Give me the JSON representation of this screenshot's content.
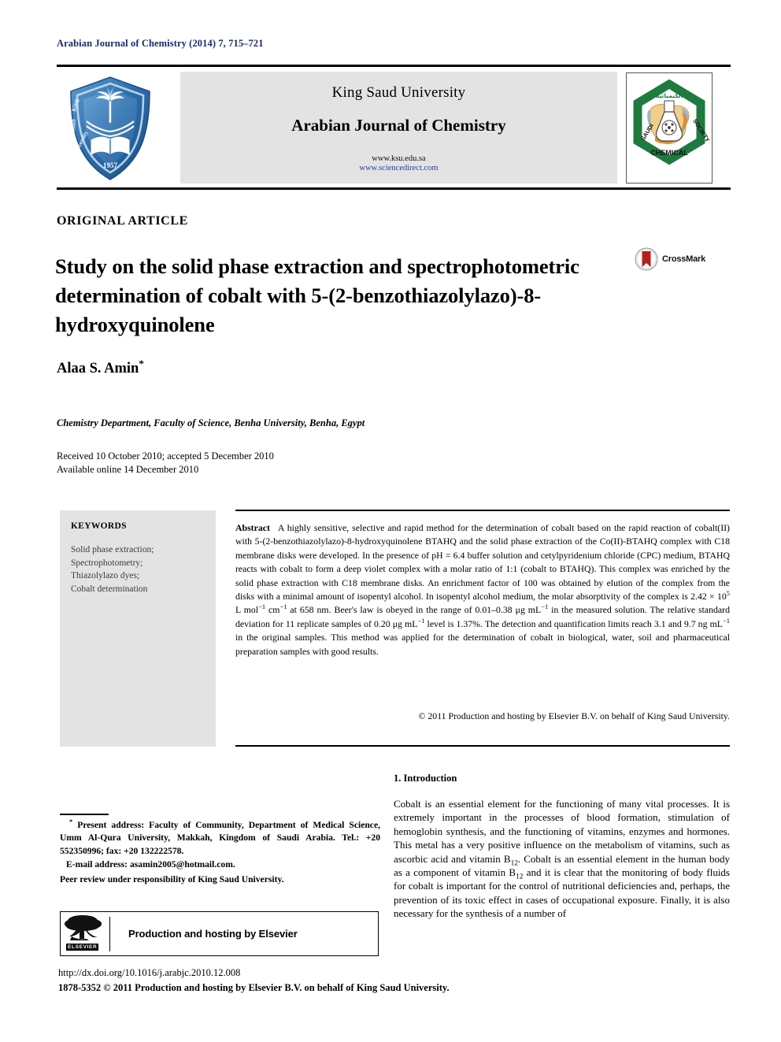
{
  "running_head": "Arabian Journal of Chemistry (2014) 7, 715–721",
  "banner": {
    "university": "King Saud University",
    "journal": "Arabian Journal of Chemistry",
    "url_ksu": "www.ksu.edu.sa",
    "url_sciencedirect": "www.sciencedirect.com",
    "left_logo": "king-saud-university-shield-logo",
    "left_logo_text_en": "King Saud University",
    "left_logo_year": "1957",
    "right_logo": "saudi-chemical-society-logo",
    "right_logo_text": [
      "SAUDI",
      "SOCIETY",
      "CHEMICAL"
    ]
  },
  "article": {
    "type": "ORIGINAL ARTICLE",
    "title": "Study on the solid phase extraction and spectrophotometric determination of cobalt with 5-(2-benzothiazolylazo)-8-hydroxyquinolene",
    "crossmark_label": "CrossMark",
    "author": "Alaa S. Amin",
    "author_marker": "*",
    "affiliation": "Chemistry Department, Faculty of Science, Benha University, Benha, Egypt",
    "received_line": "Received 10 October 2010; accepted 5 December 2010",
    "available_line": "Available online 14 December 2010"
  },
  "keywords": {
    "heading": "KEYWORDS",
    "items": [
      "Solid phase extraction;",
      "Spectrophotometry;",
      "Thiazolylazo dyes;",
      "Cobalt determination"
    ]
  },
  "abstract": {
    "label": "Abstract",
    "text_parts": {
      "p1": "A highly sensitive, selective and rapid method for the determination of cobalt based on the rapid reaction of cobalt(II) with 5-(2-benzothiazolylazo)-8-hydroxyquinolene BTAHQ and the solid phase extraction of the Co(II)-BTAHQ complex with C18 membrane disks were developed. In the presence of pH = 6.4 buffer solution and cetylpyridenium chloride (CPC) medium, BTAHQ reacts with cobalt to form a deep violet complex with a molar ratio of 1:1 (cobalt to BTAHQ). This complex was enriched by the solid phase extraction with C18 membrane disks. An enrichment factor of 100 was obtained by elution of the complex from the disks with a minimal amount of isopentyl alcohol. In isopentyl alcohol medium, the molar absorptivity of the complex is 2.42 × 10",
      "sup1": "5",
      "p2": " L mol",
      "sup2": "−1",
      "p3": " cm",
      "sup3": "−1",
      "p4": " at 658 nm. Beer's law is obeyed in the range of 0.01–0.38 μg mL",
      "sup4": "−1",
      "p5": " in the measured solution. The relative standard deviation for 11 replicate samples of 0.20 μg mL",
      "sup5": "−1",
      "p6": " level is 1.37%. The detection and quantification limits reach 3.1 and 9.7 ng mL",
      "sup6": "−1",
      "p7": " in the original samples. This method was applied for the determination of cobalt in biological, water, soil and pharmaceutical preparation samples with good results."
    },
    "copyright": "© 2011 Production and hosting by Elsevier B.V. on behalf of King Saud University."
  },
  "introduction": {
    "heading": "1. Introduction",
    "parts": {
      "t1": "Cobalt is an essential element for the functioning of many vital processes. It is extremely important in the processes of blood formation, stimulation of hemoglobin synthesis, and the functioning of vitamins, enzymes and hormones. This metal has a very positive influence on the metabolism of vitamins, such as ascorbic acid and vitamin B",
      "sub1": "12",
      "t2": ". Cobalt is an essential element in the human body as a component of vitamin B",
      "sub2": "12",
      "t3": " and it is clear that the monitoring of body fluids for cobalt is important for the control of nutritional deficiencies and, perhaps, the prevention of its toxic effect in cases of occupational exposure. Finally, it is also necessary for the synthesis of a number of"
    }
  },
  "footnotes": {
    "marker": "*",
    "present_address": "Present address: Faculty of Community, Department of Medical Science, Umm Al-Qura University, Makkah, Kingdom of Saudi Arabia. Tel.: +20 552350996; fax: +20 132222578.",
    "email_label": "E-mail address:",
    "email": "asamin2005@hotmail.com.",
    "peer_review": "Peer review under responsibility of King Saud University."
  },
  "elsevier_box": {
    "wordmark": "ELSEVIER",
    "text": "Production and hosting by Elsevier",
    "tree_icon": "elsevier-tree-logo"
  },
  "imprint": {
    "doi": "http://dx.doi.org/10.1016/j.arabjc.2010.12.008",
    "issn_line": "1878-5352 © 2011 Production and hosting by Elsevier B.V. on behalf of King Saud University."
  },
  "colors": {
    "running_head": "#1b2a6b",
    "link": "#2b3fa0",
    "panel_gray": "#e3e3e3",
    "ksu_blue": "#2e6ead",
    "scs_green": "#1f7a3f",
    "crossmark_red": "#b3211f"
  }
}
